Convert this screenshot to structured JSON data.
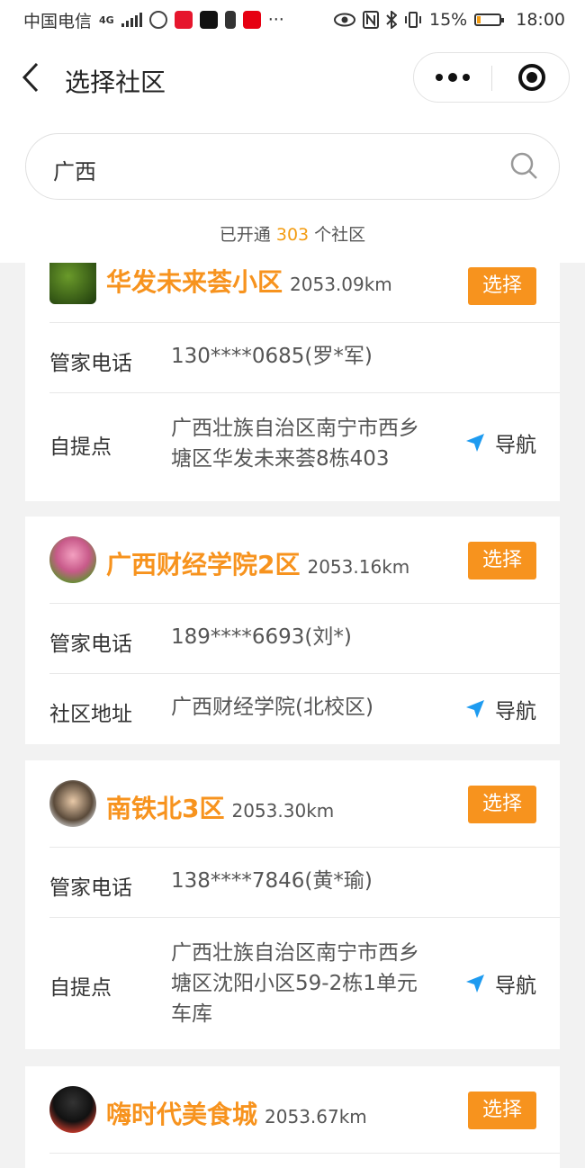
{
  "status_bar": {
    "carrier": "中国电信",
    "network": "4G",
    "battery": "15%",
    "battery_level": 0.15,
    "time": "18:00",
    "apps": [
      "#ffffff",
      "#e6162d",
      "#111111",
      "#333333",
      "#e60012"
    ]
  },
  "nav": {
    "title": "选择社区"
  },
  "search": {
    "value": "广西"
  },
  "summary": {
    "prefix": "已开通",
    "count": "303",
    "suffix": "个社区"
  },
  "communities": [
    {
      "name": "华发未来荟小区",
      "distance": "2053.09km",
      "select_label": "选择",
      "phone_label": "管家电话",
      "phone": "130****0685(罗*军)",
      "addr_label": "自提点",
      "address_lines": [
        "广西壮族自治区南宁市西乡",
        "塘区华发未来荟8栋403"
      ],
      "nav_label": "导航"
    },
    {
      "name": "广西财经学院2区",
      "distance": "2053.16km",
      "select_label": "选择",
      "phone_label": "管家电话",
      "phone": "189****6693(刘*)",
      "addr_label": "社区地址",
      "address_lines": [
        "广西财经学院(北校区)"
      ],
      "nav_label": "导航"
    },
    {
      "name": "南铁北3区",
      "distance": "2053.30km",
      "select_label": "选择",
      "phone_label": "管家电话",
      "phone": "138****7846(黄*瑜)",
      "addr_label": "自提点",
      "address_lines": [
        "广西壮族自治区南宁市西乡",
        "塘区沈阳小区59-2栋1单元",
        "车库"
      ],
      "nav_label": "导航"
    },
    {
      "name": "嗨时代美食城",
      "distance": "2053.67km",
      "select_label": "选择"
    }
  ]
}
